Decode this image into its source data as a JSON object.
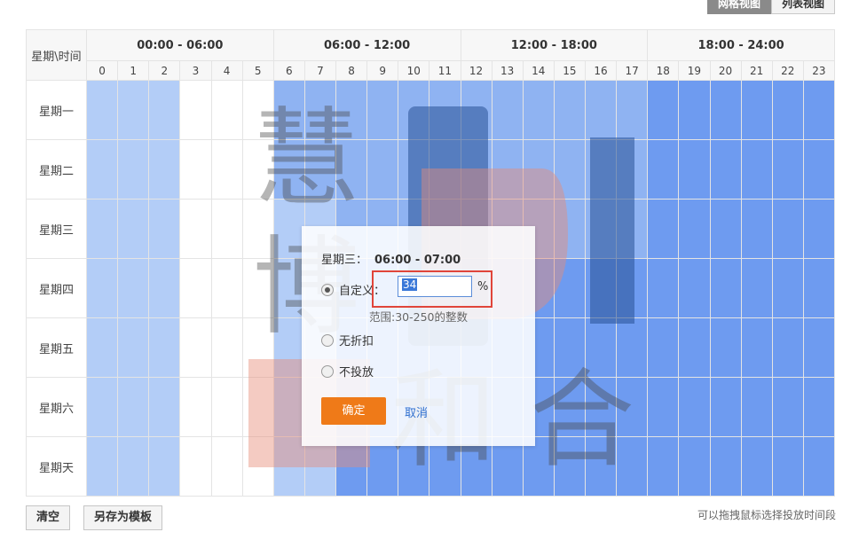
{
  "view_toggle": {
    "grid_label": "网格视图",
    "list_label": "列表视图"
  },
  "grid": {
    "corner_label": "星期\\时间",
    "ranges": [
      "00:00 - 06:00",
      "06:00 - 12:00",
      "12:00 - 18:00",
      "18:00 - 24:00"
    ],
    "hours": [
      "0",
      "1",
      "2",
      "3",
      "4",
      "5",
      "6",
      "7",
      "8",
      "9",
      "10",
      "11",
      "12",
      "13",
      "14",
      "15",
      "16",
      "17",
      "18",
      "19",
      "20",
      "21",
      "22",
      "23"
    ],
    "days": [
      "星期一",
      "星期二",
      "星期三",
      "星期四",
      "星期五",
      "星期六",
      "星期天"
    ],
    "cell_levels": {
      "星期一": [
        "light",
        "light",
        "light",
        "none",
        "none",
        "none",
        "mid",
        "mid",
        "mid",
        "mid",
        "mid",
        "mid",
        "mid",
        "mid",
        "mid",
        "mid",
        "mid",
        "mid",
        "dark",
        "dark",
        "dark",
        "dark",
        "dark",
        "dark"
      ],
      "星期二": [
        "light",
        "light",
        "light",
        "none",
        "none",
        "none",
        "mid",
        "mid",
        "mid",
        "mid",
        "mid",
        "mid",
        "mid",
        "mid",
        "mid",
        "mid",
        "mid",
        "mid",
        "dark",
        "dark",
        "dark",
        "dark",
        "dark",
        "dark"
      ],
      "星期三": [
        "light",
        "light",
        "light",
        "none",
        "none",
        "none",
        "light",
        "light",
        "mid",
        "mid",
        "mid",
        "mid",
        "mid",
        "mid",
        "mid",
        "mid",
        "mid",
        "mid",
        "dark",
        "dark",
        "dark",
        "dark",
        "dark",
        "dark"
      ],
      "星期四": [
        "light",
        "light",
        "light",
        "none",
        "none",
        "none",
        "light",
        "light",
        "dark",
        "dark",
        "dark",
        "dark",
        "dark",
        "dark",
        "dark",
        "dark",
        "dark",
        "dark",
        "dark",
        "dark",
        "dark",
        "dark",
        "dark",
        "dark"
      ],
      "星期五": [
        "light",
        "light",
        "light",
        "none",
        "none",
        "none",
        "light",
        "light",
        "dark",
        "dark",
        "dark",
        "dark",
        "dark",
        "dark",
        "dark",
        "dark",
        "dark",
        "dark",
        "dark",
        "dark",
        "dark",
        "dark",
        "dark",
        "dark"
      ],
      "星期六": [
        "light",
        "light",
        "light",
        "none",
        "none",
        "none",
        "light",
        "light",
        "dark",
        "dark",
        "dark",
        "dark",
        "dark",
        "dark",
        "dark",
        "dark",
        "dark",
        "dark",
        "dark",
        "dark",
        "dark",
        "dark",
        "dark",
        "dark"
      ],
      "星期天": [
        "light",
        "light",
        "light",
        "none",
        "none",
        "none",
        "light",
        "light",
        "dark",
        "dark",
        "dark",
        "dark",
        "dark",
        "dark",
        "dark",
        "dark",
        "dark",
        "dark",
        "dark",
        "dark",
        "dark",
        "dark",
        "dark",
        "dark"
      ]
    },
    "colors": {
      "none": "#ffffff",
      "light": "#b3cdf7",
      "mid": "#8fb3f2",
      "dark": "#6e9bf0"
    }
  },
  "popup": {
    "day_label": "星期三：",
    "time_label": "06:00 - 07:00",
    "custom_label": "自定义：",
    "custom_value": "34",
    "percent_sign": "%",
    "range_hint": "范围:30-250的整数",
    "no_discount_label": "无折扣",
    "no_delivery_label": "不投放",
    "confirm_label": "确定",
    "cancel_label": "取消"
  },
  "watermark": {
    "chars": [
      "慧",
      "博",
      "和",
      "合"
    ]
  },
  "footer": {
    "clear_label": "清空",
    "save_template_label": "另存为模板",
    "hint": "可以拖拽鼠标选择投放时间段"
  }
}
